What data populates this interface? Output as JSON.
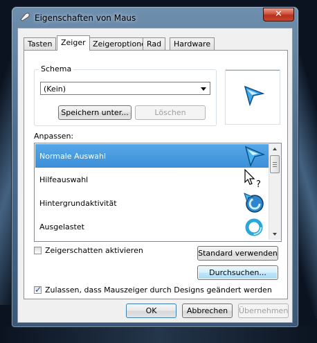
{
  "window": {
    "title": "Eigenschaften von Maus",
    "close_glyph": "✕"
  },
  "tabs": [
    {
      "label": "Tasten",
      "active": false
    },
    {
      "label": "Zeiger",
      "active": true
    },
    {
      "label": "Zeigeroptionen",
      "active": false
    },
    {
      "label": "Rad",
      "active": false
    },
    {
      "label": "Hardware",
      "active": false
    }
  ],
  "scheme": {
    "group_label": "Schema",
    "selected": "(Kein)",
    "save_label": "Speichern unter...",
    "delete_label": "Löschen"
  },
  "customize": {
    "label": "Anpassen:",
    "items": [
      {
        "label": "Normale Auswahl",
        "icon": "arrow-cursor-icon",
        "selected": true
      },
      {
        "label": "Hilfeauswahl",
        "icon": "help-cursor-icon",
        "selected": false
      },
      {
        "label": "Hintergrundaktivität",
        "icon": "working-in-background-cursor-icon",
        "selected": false
      },
      {
        "label": "Ausgelastet",
        "icon": "busy-cursor-icon",
        "selected": false
      }
    ]
  },
  "options": {
    "shadow_label": "Zeigerschatten aktivieren",
    "shadow_checked": false,
    "default_label": "Standard verwenden",
    "browse_label": "Durchsuchen...",
    "themes_label": "Zulassen, dass Mauszeiger durch Designs geändert werden",
    "themes_checked": true
  },
  "footer": {
    "ok_label": "OK",
    "cancel_label": "Abbrechen",
    "apply_label": "Übernehmen"
  },
  "colors": {
    "selection": "#3c8fd8",
    "cursor_blue": "#2a8fd8",
    "close_red": "#c8462e"
  }
}
